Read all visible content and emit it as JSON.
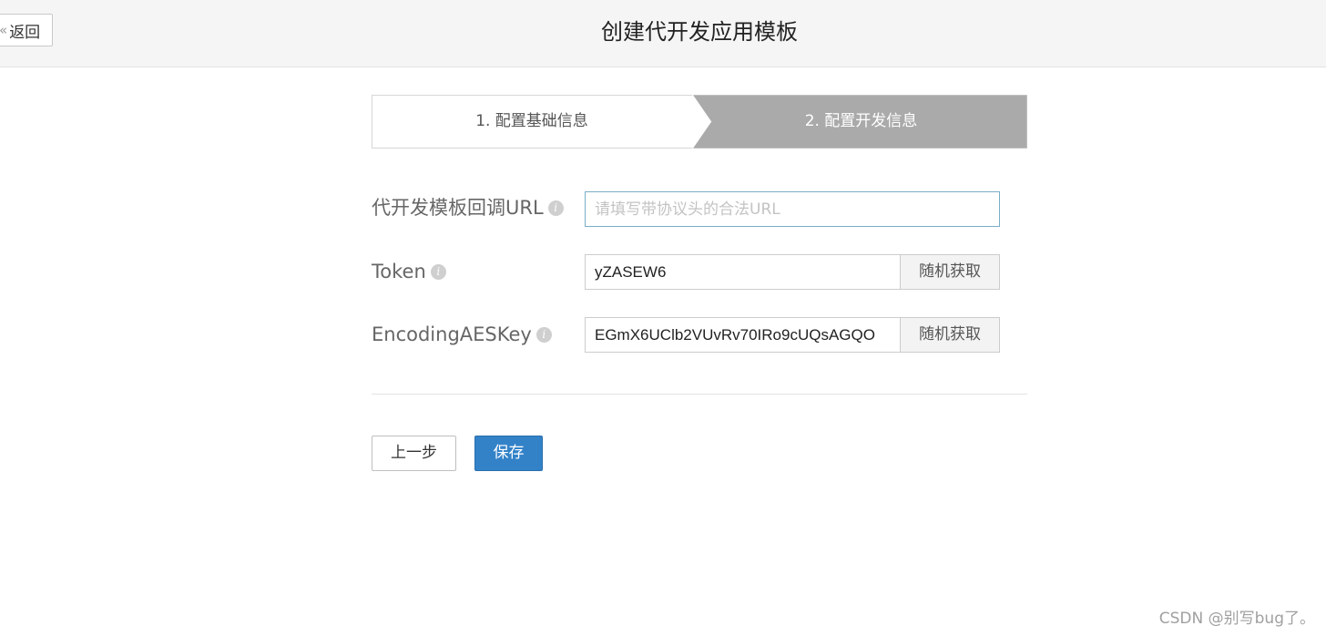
{
  "header": {
    "back_label": "返回",
    "back_icon": "chevron-left-icon",
    "title": "创建代开发应用模板"
  },
  "steps": [
    {
      "label": "1. 配置基础信息",
      "active": false
    },
    {
      "label": "2. 配置开发信息",
      "active": true
    }
  ],
  "form": {
    "url": {
      "label": "代开发模板回调URL",
      "placeholder": "请填写带协议头的合法URL",
      "value": ""
    },
    "token": {
      "label": "Token",
      "value": "yZASEW6",
      "button_label": "随机获取"
    },
    "aes_key": {
      "label": "EncodingAESKey",
      "value": "EGmX6UClb2VUvRv70IRo9cUQsAGQO",
      "button_label": "随机获取"
    }
  },
  "actions": {
    "prev_label": "上一步",
    "save_label": "保存"
  },
  "watermark": "CSDN @别写bug了。",
  "colors": {
    "active_step_bg": "#aaaaaa",
    "primary": "#3382c8",
    "input_focus_border": "#7aaec6"
  }
}
